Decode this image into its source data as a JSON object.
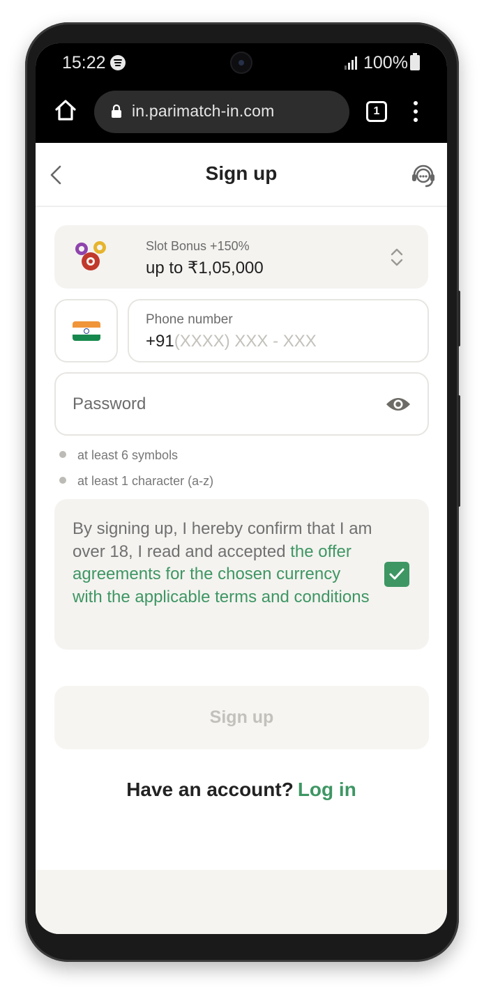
{
  "status_bar": {
    "time": "15:22",
    "battery": "100%"
  },
  "browser": {
    "url": "in.parimatch-in.com",
    "tab_count": "1"
  },
  "header": {
    "title": "Sign up"
  },
  "bonus": {
    "label": "Slot Bonus +150%",
    "amount": "up to ₹1,05,000"
  },
  "phone": {
    "label": "Phone number",
    "prefix": "+91",
    "placeholder": "(XXXX) XXX - XXX"
  },
  "password": {
    "placeholder": "Password"
  },
  "rules": [
    "at least 6 symbols",
    "at least 1 character (a-z)"
  ],
  "consent": {
    "text": "By signing up, I hereby confirm that I am over 18, I read and accepted ",
    "link": "the offer agreements for the chosen currency with the applicable terms and conditions",
    "checked": true
  },
  "signup_button": "Sign up",
  "login": {
    "prompt": "Have an account?",
    "link": "Log in"
  },
  "colors": {
    "accent": "#3e9663",
    "field_bg": "#f4f3f0"
  },
  "icons": [
    "home-icon",
    "lock-icon",
    "tabs-icon",
    "menu-icon",
    "back-icon",
    "support-icon",
    "chips-icon",
    "updown-icon",
    "india-flag-icon",
    "eye-icon",
    "check-icon"
  ]
}
